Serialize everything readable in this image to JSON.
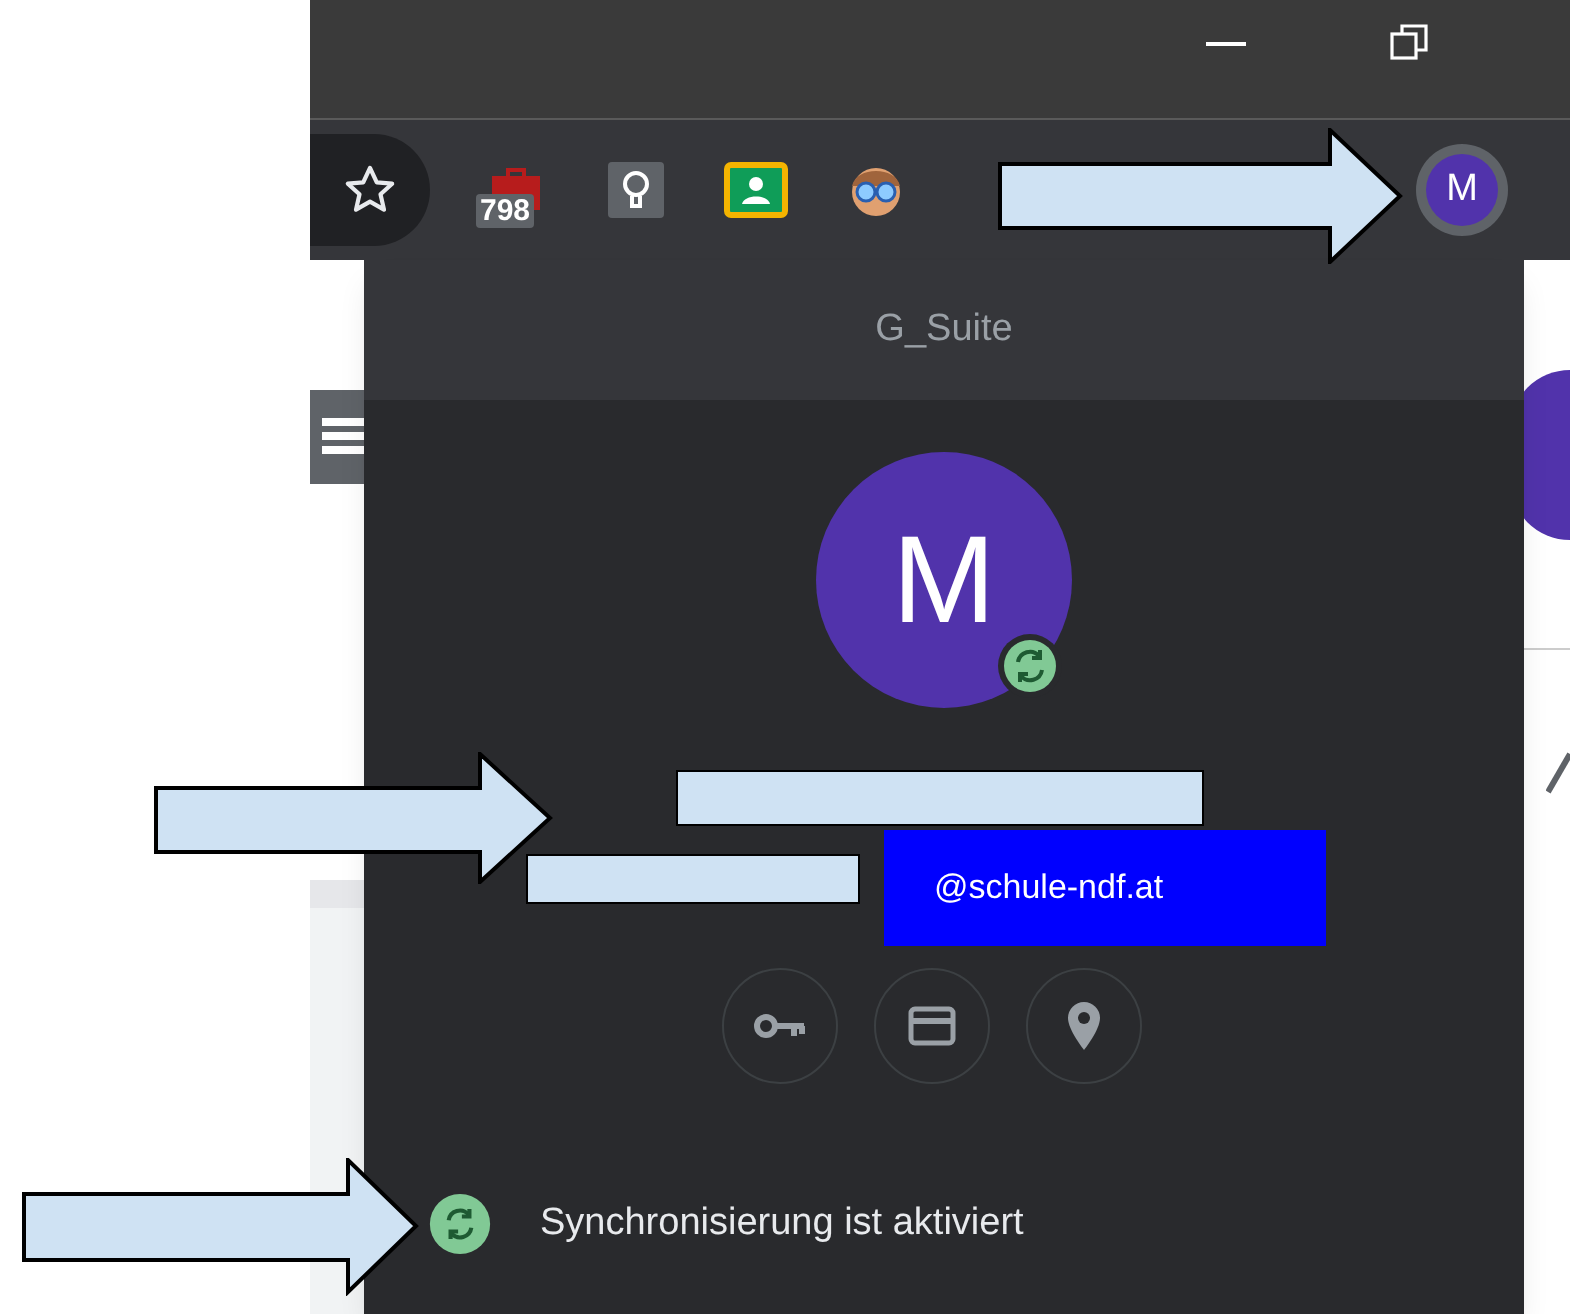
{
  "toolbar": {
    "extensions": [
      {
        "kind": "red",
        "badge": "798"
      },
      {
        "kind": "bulb"
      },
      {
        "kind": "classroom"
      },
      {
        "kind": "face"
      }
    ],
    "profile": {
      "letter": "M"
    }
  },
  "profile_menu": {
    "title": "G_Suite",
    "avatar_letter": "M",
    "email": "@schule-ndf.at",
    "sync": {
      "label": "Synchronisierung ist aktiviert",
      "on": true
    }
  }
}
